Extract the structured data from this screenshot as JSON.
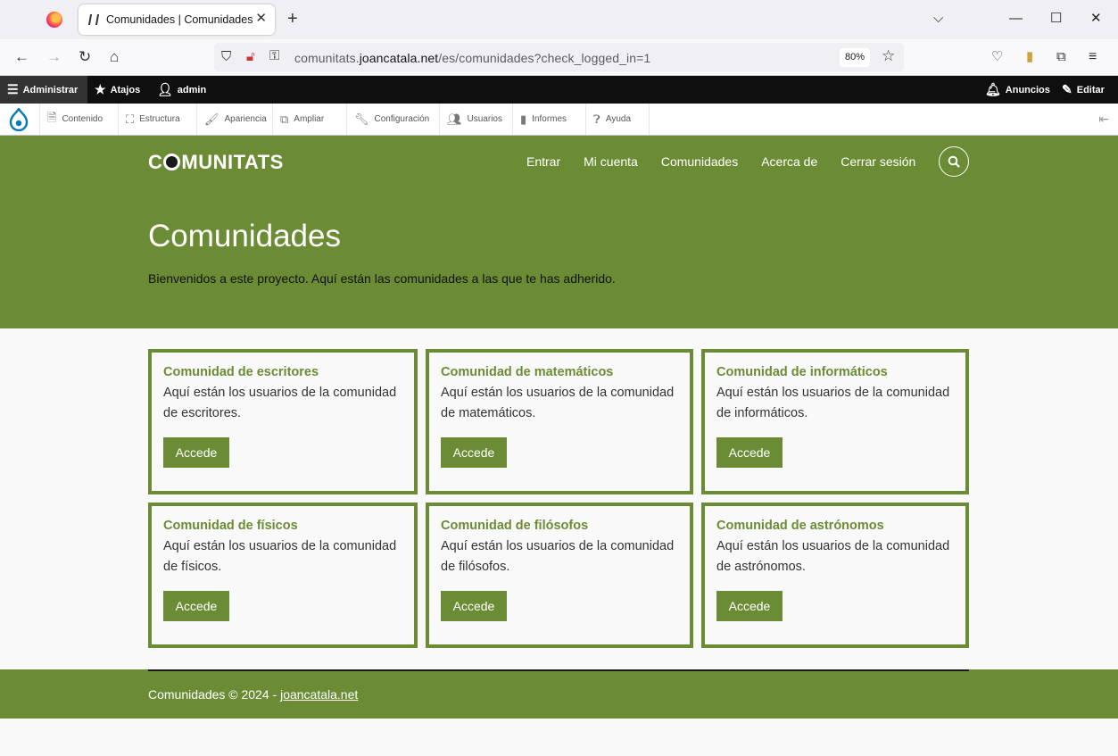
{
  "browser": {
    "tab_title": "Comunidades | Comunidades",
    "url_prefix": "comunitats.",
    "url_host": "joancatala.net",
    "url_path": "/es/comunidades?check_logged_in=1",
    "zoom": "80%"
  },
  "admin_toolbar": {
    "manage": "Administrar",
    "shortcuts": "Atajos",
    "user": "admin",
    "announcements": "Anuncios",
    "edit": "Editar"
  },
  "admin_tray": {
    "items": [
      "Contenido",
      "Estructura",
      "Apariencia",
      "Ampliar",
      "Configuración",
      "Usuarios",
      "Informes",
      "Ayuda"
    ]
  },
  "site": {
    "logo_pre": "C",
    "logo_post": "MUNITATS",
    "menu": [
      "Entrar",
      "Mi cuenta",
      "Comunidades",
      "Acerca de",
      "Cerrar sesión"
    ],
    "page_title": "Comunidades",
    "intro": "Bienvenidos a este proyecto. Aquí están las comunidades a las que te has adherido."
  },
  "cards": [
    {
      "title": "Comunidad de escritores",
      "desc": "Aquí están los usuarios de la comunidad de escritores.",
      "button": "Accede"
    },
    {
      "title": "Comunidad de matemáticos",
      "desc": "Aquí están los usuarios de la comunidad de matemáticos.",
      "button": "Accede"
    },
    {
      "title": "Comunidad de informáticos",
      "desc": "Aquí están los usuarios de la comunidad de informáticos.",
      "button": "Accede"
    },
    {
      "title": "Comunidad de físicos",
      "desc": "Aquí están los usuarios de la comunidad de físicos.",
      "button": "Accede"
    },
    {
      "title": "Comunidad de filósofos",
      "desc": "Aquí están los usuarios de la comunidad de filósofos.",
      "button": "Accede"
    },
    {
      "title": "Comunidad de astrónomos",
      "desc": "Aquí están los usuarios de la comunidad de astrónomos.",
      "button": "Accede"
    }
  ],
  "footer": {
    "text": "Comunidades © 2024 - ",
    "link": "joancatala.net"
  },
  "colors": {
    "brand_green": "#6b8c35",
    "admin_bar": "#0f0f0f"
  }
}
